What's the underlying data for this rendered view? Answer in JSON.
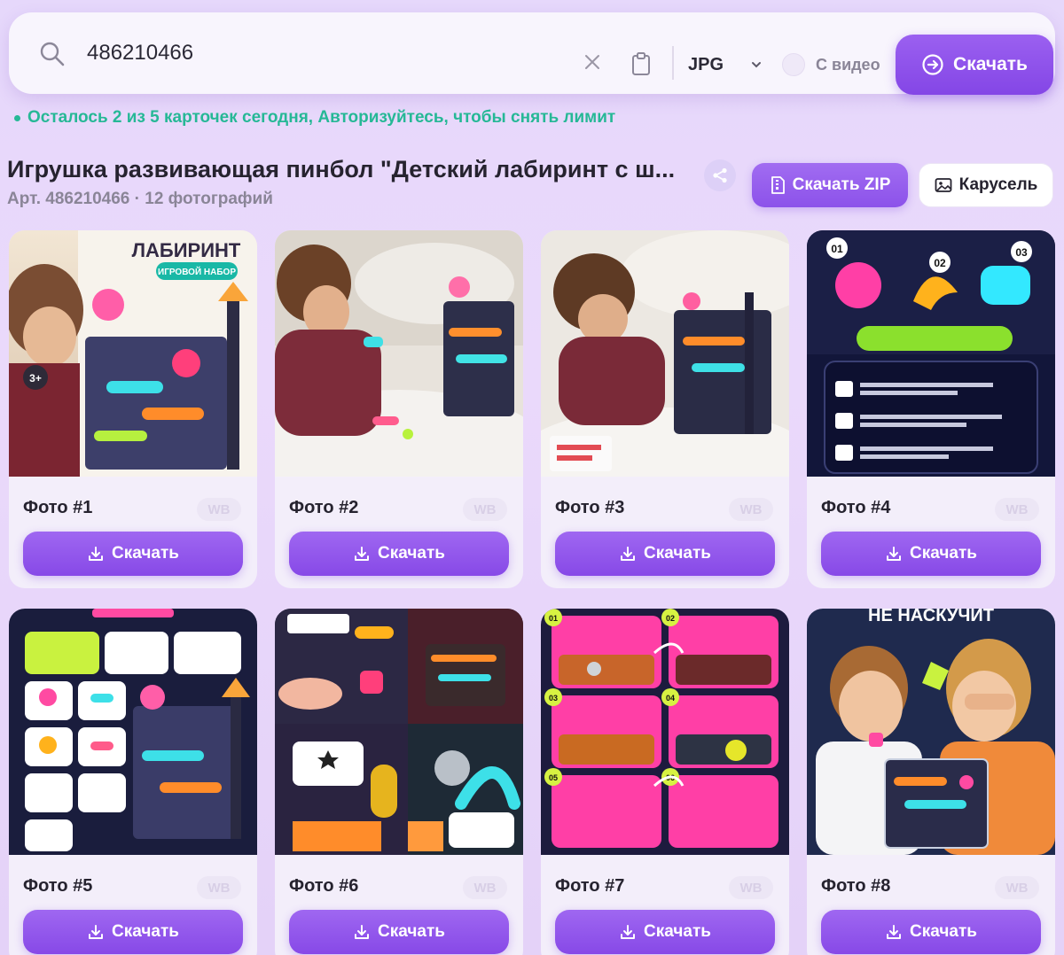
{
  "search": {
    "value": "486210466",
    "format": "JPG",
    "video_label": "С видео",
    "download_label": "Скачать"
  },
  "limit_note": "Осталось 2 из 5 карточек сегодня, Авторизуйтесь, чтобы снять лимит",
  "product": {
    "title": "Игрушка развивающая пинбол \"Детский лабиринт с ш...",
    "meta": "Арт. 486210466 · 12 фотографий",
    "zip_label": "Скачать ZIP",
    "carousel_label": "Карусель"
  },
  "photos": [
    {
      "label": "Фото #1",
      "badge": "WB",
      "download": "Скачать",
      "banner_text": "ЛАБИРИНТ",
      "badge_text": "ИГРОВОЙ НАБОР",
      "age_text": "3+"
    },
    {
      "label": "Фото #2",
      "badge": "WB",
      "download": "Скачать"
    },
    {
      "label": "Фото #3",
      "badge": "WB",
      "download": "Скачать"
    },
    {
      "label": "Фото #4",
      "badge": "WB",
      "download": "Скачать",
      "step_labels": [
        "01",
        "02",
        "03"
      ]
    },
    {
      "label": "Фото #5",
      "badge": "WB",
      "download": "Скачать"
    },
    {
      "label": "Фото #6",
      "badge": "WB",
      "download": "Скачать"
    },
    {
      "label": "Фото #7",
      "badge": "WB",
      "download": "Скачать",
      "step_labels": [
        "01",
        "02",
        "03",
        "04",
        "05",
        "06"
      ]
    },
    {
      "label": "Фото #8",
      "badge": "WB",
      "download": "Скачать",
      "banner_text": "НЕ НАСКУЧИТ"
    }
  ],
  "colors": {
    "accent": "#8a4ee8",
    "success": "#26b896",
    "background": "#e6d8fb"
  }
}
